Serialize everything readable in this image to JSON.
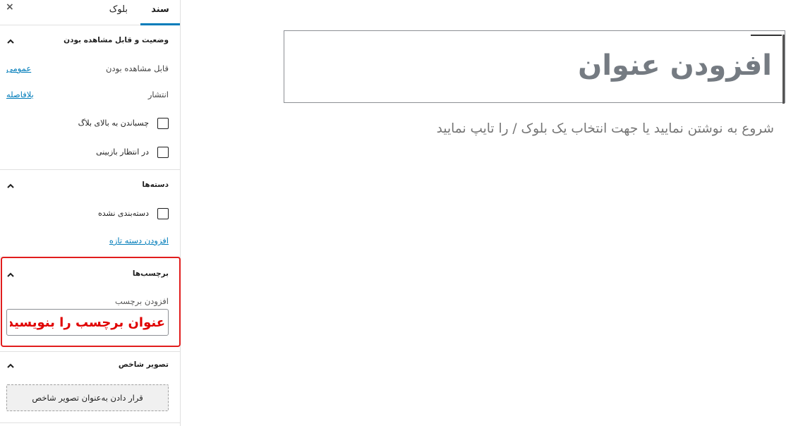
{
  "tabs": {
    "document": "سند",
    "block": "بلوک"
  },
  "close_symbol": "×",
  "status": {
    "title": "وضعیت و قابل مشاهده بودن",
    "visibility_label": "قابل مشاهده بودن",
    "visibility_value": "عمومی",
    "publish_label": "انتشار",
    "publish_value": "بلافاصله",
    "stick_label": "چسباندن به بالای بلاگ",
    "pending_label": "در انتظار بازبینی"
  },
  "categories": {
    "title": "دسته‌ها",
    "uncategorized": "دسته‌بندی نشده",
    "add_new": "افزودن دسته تازه"
  },
  "tags": {
    "title": "برچسب‌ها",
    "add_label": "افزودن برچسب",
    "input_value": "عنوان برچسب را بنویسید"
  },
  "featured": {
    "title": "تصویر شاخص",
    "button": "قرار دادن به‌عنوان تصویر شاخص"
  },
  "editor": {
    "title_placeholder": "افزودن عنوان",
    "block_placeholder": "شروع به نوشتن نمایید یا جهت انتخاب یک بلوک / را تایپ نمایید"
  },
  "colors": {
    "accent": "#007cba",
    "highlight": "#e11d1d",
    "tag_text": "#e00000"
  }
}
